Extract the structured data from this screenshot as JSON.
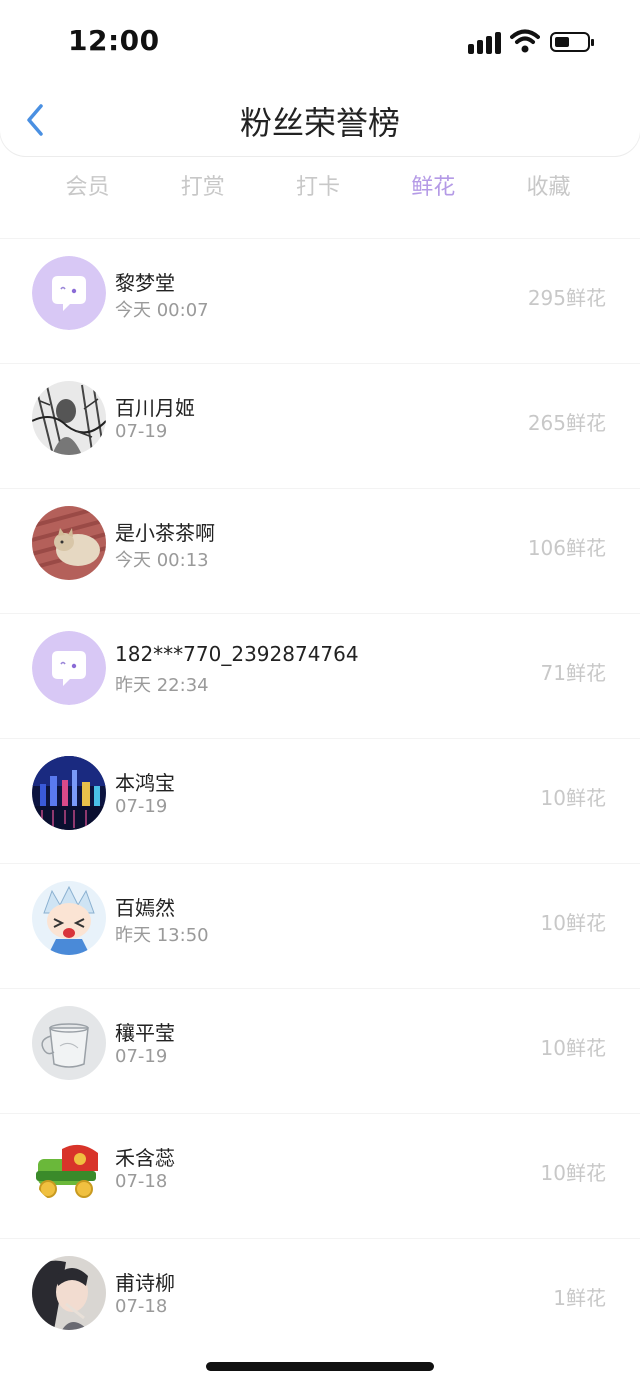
{
  "status_bar": {
    "time": "12:00",
    "signal_icon": "cellular-signal-icon",
    "wifi_icon": "wifi-icon",
    "battery_icon": "battery-icon",
    "battery_level": 0.35
  },
  "header": {
    "title": "粉丝荣誉榜",
    "back_icon": "chevron-left-icon",
    "accent_color": "#4a90e2"
  },
  "tabs": [
    {
      "label": "会员",
      "active": false
    },
    {
      "label": "打赏",
      "active": false
    },
    {
      "label": "打卡",
      "active": false
    },
    {
      "label": "鲜花",
      "active": true
    },
    {
      "label": "收藏",
      "active": false
    }
  ],
  "active_tab_color": "#b49ae6",
  "fans": [
    {
      "name": "黎梦堂",
      "time": "今天 00:07",
      "count": "295鲜花",
      "avatar": "default-chat-avatar"
    },
    {
      "name": "百川月姬",
      "time": "07-19",
      "count": "265鲜花",
      "avatar": "ink-drawing-avatar"
    },
    {
      "name": "是小茶茶啊",
      "time": "今天 00:13",
      "count": "106鲜花",
      "avatar": "cat-photo-avatar"
    },
    {
      "name": "182***770_2392874764",
      "time": "昨天 22:34",
      "count": "71鲜花",
      "avatar": "default-chat-avatar"
    },
    {
      "name": "本鸿宝",
      "time": "07-19",
      "count": "10鲜花",
      "avatar": "night-city-avatar"
    },
    {
      "name": "百嫣然",
      "time": "昨天 13:50",
      "count": "10鲜花",
      "avatar": "anime-character-avatar"
    },
    {
      "name": "穰平莹",
      "time": "07-19",
      "count": "10鲜花",
      "avatar": "glass-cup-avatar"
    },
    {
      "name": "禾含蕊",
      "time": "07-18",
      "count": "10鲜花",
      "avatar": "toy-truck-avatar"
    },
    {
      "name": "甫诗柳",
      "time": "07-18",
      "count": "1鲜花",
      "avatar": "girl-photo-avatar"
    }
  ]
}
